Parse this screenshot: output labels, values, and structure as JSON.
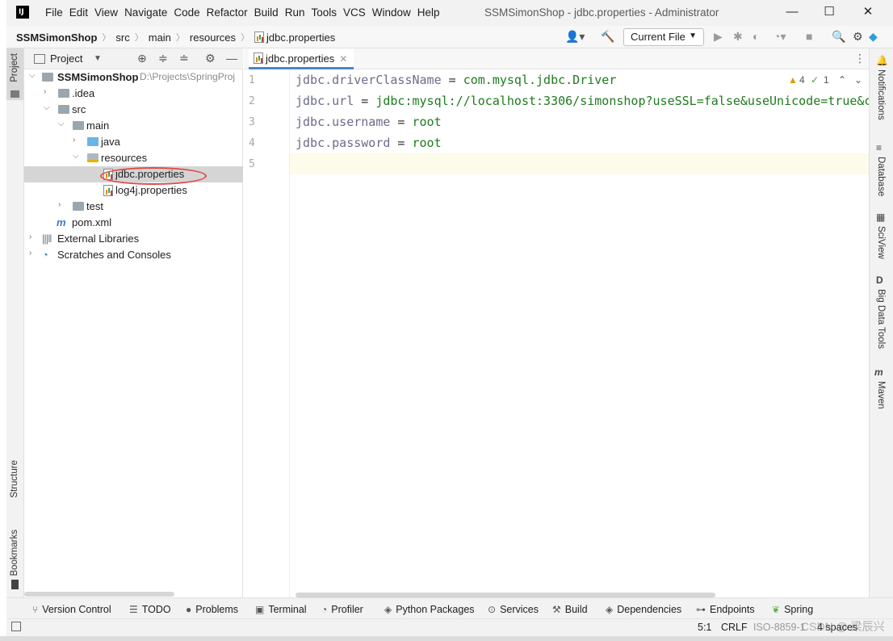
{
  "window": {
    "title": "SSMSimonShop - jdbc.properties - Administrator",
    "menu": [
      "File",
      "Edit",
      "View",
      "Navigate",
      "Code",
      "Refactor",
      "Build",
      "Run",
      "Tools",
      "VCS",
      "Window",
      "Help"
    ],
    "minimize": "—",
    "maximize": "☐",
    "close": "✕"
  },
  "navbar": {
    "breadcrumbs": [
      "SSMSimonShop",
      "src",
      "main",
      "resources",
      "jdbc.properties"
    ],
    "run_config": "Current File"
  },
  "left_strip": {
    "project": "Project",
    "structure": "Structure",
    "bookmarks": "Bookmarks"
  },
  "project_panel": {
    "title": "Project",
    "tree": [
      {
        "label": "SSMSimonShop",
        "path": "D:\\Projects\\SpringProj"
      },
      {
        "label": ".idea"
      },
      {
        "label": "src"
      },
      {
        "label": "main"
      },
      {
        "label": "java"
      },
      {
        "label": "resources"
      },
      {
        "label": "jdbc.properties"
      },
      {
        "label": "log4j.properties"
      },
      {
        "label": "test"
      },
      {
        "label": "pom.xml"
      },
      {
        "label": "External Libraries"
      },
      {
        "label": "Scratches and Consoles"
      }
    ]
  },
  "editor": {
    "tab_label": "jdbc.properties",
    "line_numbers": [
      "1",
      "2",
      "3",
      "4",
      "5"
    ],
    "lines": [
      {
        "key": "jdbc.driverClassName",
        "eq": " = ",
        "value": "com.mysql.jdbc.Driver"
      },
      {
        "key": "jdbc.url",
        "eq": " = ",
        "value": "jdbc:mysql://localhost:3306/simonshop?useSSL=false&useUnicode=true&c"
      },
      {
        "key": "jdbc.username",
        "eq": " = ",
        "value": "root"
      },
      {
        "key": "jdbc.password",
        "eq": " = ",
        "value": "root"
      }
    ],
    "warnings": "4",
    "weak_warnings": "1"
  },
  "right_strip": {
    "notifications": "Notifications",
    "database": "Database",
    "sciview": "SciView",
    "bigdata": "Big Data Tools",
    "maven": "Maven"
  },
  "bottom_tools": [
    "Version Control",
    "TODO",
    "Problems",
    "Terminal",
    "Profiler",
    "Python Packages",
    "Services",
    "Build",
    "Dependencies",
    "Endpoints",
    "Spring"
  ],
  "status": {
    "position": "5:1",
    "line_sep": "CRLF",
    "encoding": "ISO-8859-1",
    "indent": "4 spaces"
  },
  "watermark": "CSDN @ 梁辰兴",
  "colors": {
    "key": "#6c6c8a",
    "value": "#1f7a1f",
    "selection": "#d5d5d5",
    "annotation_ring": "#e04848"
  }
}
